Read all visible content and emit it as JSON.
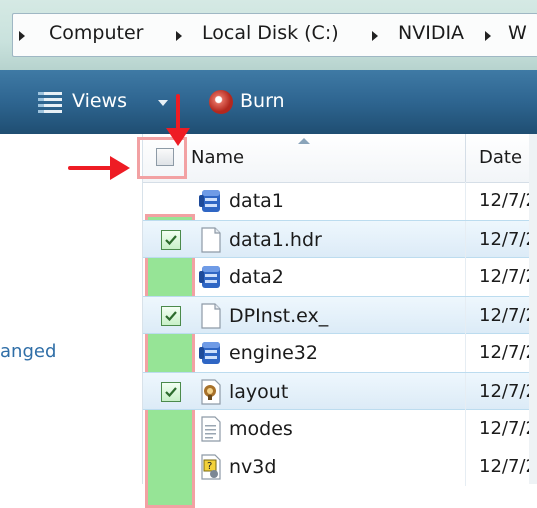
{
  "address_bar": {
    "crumbs": [
      "Computer",
      "Local Disk (C:)",
      "NVIDIA",
      "W"
    ]
  },
  "toolbar": {
    "views_label": "Views",
    "burn_label": "Burn"
  },
  "nav_pane": {
    "partial_text": "anged"
  },
  "columns": {
    "name": "Name",
    "date": "Date m"
  },
  "files": [
    {
      "name": "data1",
      "date": "12/7/2",
      "icon": "cab-icon",
      "checked": false,
      "selected": false
    },
    {
      "name": "data1.hdr",
      "date": "12/7/2",
      "icon": "blank-file-icon",
      "checked": true,
      "selected": true
    },
    {
      "name": "data2",
      "date": "12/7/2",
      "icon": "cab-icon",
      "checked": false,
      "selected": false
    },
    {
      "name": "DPInst.ex_",
      "date": "12/7/2",
      "icon": "blank-file-icon",
      "checked": true,
      "selected": true
    },
    {
      "name": "engine32",
      "date": "12/7/2",
      "icon": "cab-icon",
      "checked": false,
      "selected": false
    },
    {
      "name": "layout",
      "date": "12/7/2",
      "icon": "package-icon",
      "checked": true,
      "selected": true
    },
    {
      "name": "modes",
      "date": "12/7/2",
      "icon": "text-file-icon",
      "checked": false,
      "selected": false
    },
    {
      "name": "nv3d",
      "date": "12/7/2",
      "icon": "settings-file-icon",
      "checked": false,
      "selected": false
    }
  ],
  "colors": {
    "annotation_arrow": "#ee1c24",
    "annotation_box": "#f2a1a3",
    "annotation_highlight": "#78dc78",
    "toolbar": "#2e6590",
    "selection": "#dcebf7"
  }
}
